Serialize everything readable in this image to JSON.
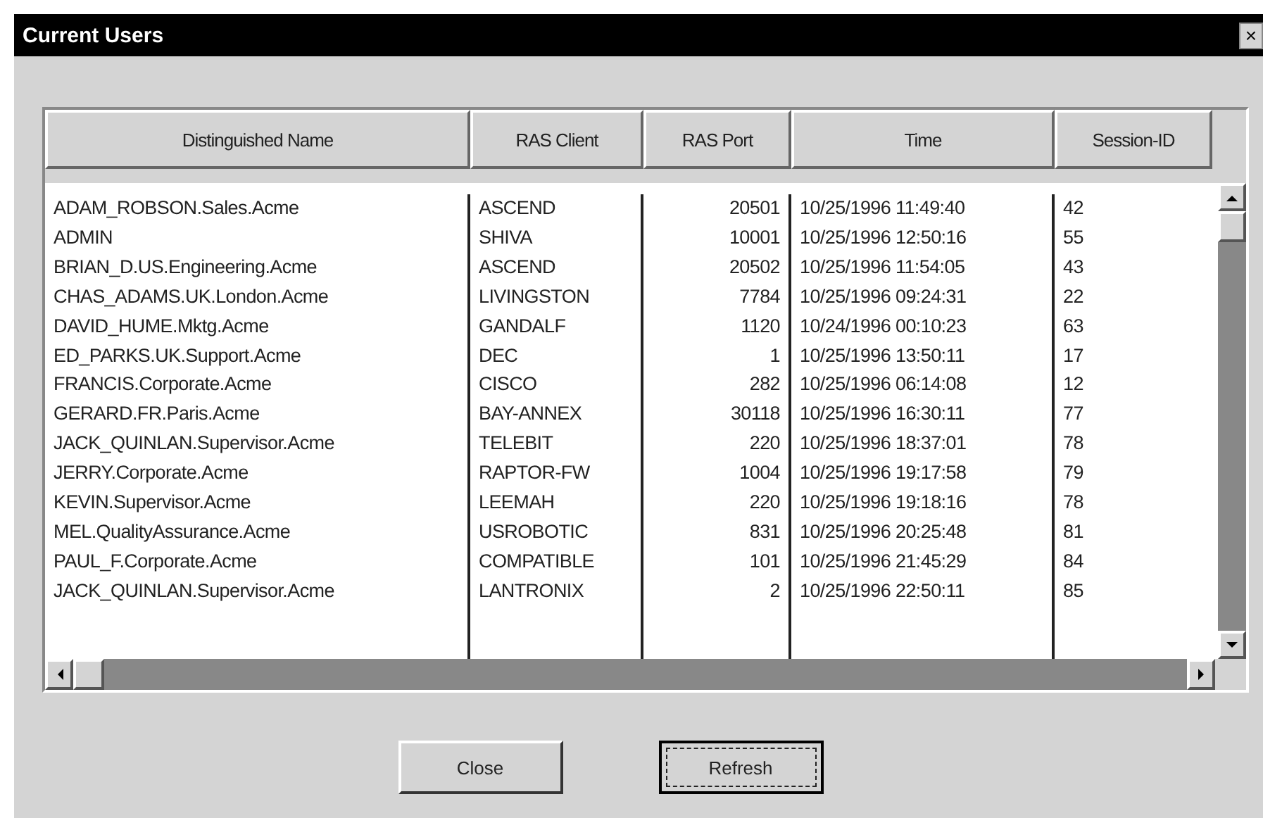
{
  "window": {
    "title": "Current Users",
    "close": "×"
  },
  "table": {
    "columns": [
      "Distinguished Name",
      "RAS Client",
      "RAS Port",
      "Time",
      "Session-ID"
    ],
    "rows": [
      [
        "ADAM_ROBSON.Sales.Acme",
        "ASCEND",
        "20501",
        "10/25/1996 11:49:40",
        "42"
      ],
      [
        "ADMIN",
        "SHIVA",
        "10001",
        "10/25/1996 12:50:16",
        "55"
      ],
      [
        "BRIAN_D.US.Engineering.Acme",
        "ASCEND",
        "20502",
        "10/25/1996 11:54:05",
        "43"
      ],
      [
        "CHAS_ADAMS.UK.London.Acme",
        "LIVINGSTON",
        "7784",
        "10/25/1996 09:24:31",
        "22"
      ],
      [
        "DAVID_HUME.Mktg.Acme",
        "GANDALF",
        "1120",
        "10/24/1996 00:10:23",
        "63"
      ],
      [
        "ED_PARKS.UK.Support.Acme",
        "DEC",
        "1",
        "10/25/1996 13:50:11",
        "17"
      ],
      [
        "FRANCIS.Corporate.Acme",
        "CISCO",
        "282",
        "10/25/1996 06:14:08",
        "12"
      ],
      [
        "GERARD.FR.Paris.Acme",
        "BAY-ANNEX",
        "30118",
        "10/25/1996 16:30:11",
        "77"
      ],
      [
        "JACK_QUINLAN.Supervisor.Acme",
        "TELEBIT",
        "220",
        "10/25/1996 18:37:01",
        "78"
      ],
      [
        "JERRY.Corporate.Acme",
        "RAPTOR-FW",
        "1004",
        "10/25/1996 19:17:58",
        "79"
      ],
      [
        "KEVIN.Supervisor.Acme",
        "LEEMAH",
        "220",
        "10/25/1996 19:18:16",
        "78"
      ],
      [
        "MEL.QualityAssurance.Acme",
        "USROBOTIC",
        "831",
        "10/25/1996 20:25:48",
        "81"
      ],
      [
        "PAUL_F.Corporate.Acme",
        "COMPATIBLE",
        "101",
        "10/25/1996 21:45:29",
        "84"
      ],
      [
        "JACK_QUINLAN.Supervisor.Acme",
        "LANTRONIX",
        "2",
        "10/25/1996 22:50:11",
        "85"
      ]
    ]
  },
  "buttons": [
    {
      "label": "Close",
      "focused": false
    },
    {
      "label": "Refresh",
      "focused": true
    }
  ]
}
